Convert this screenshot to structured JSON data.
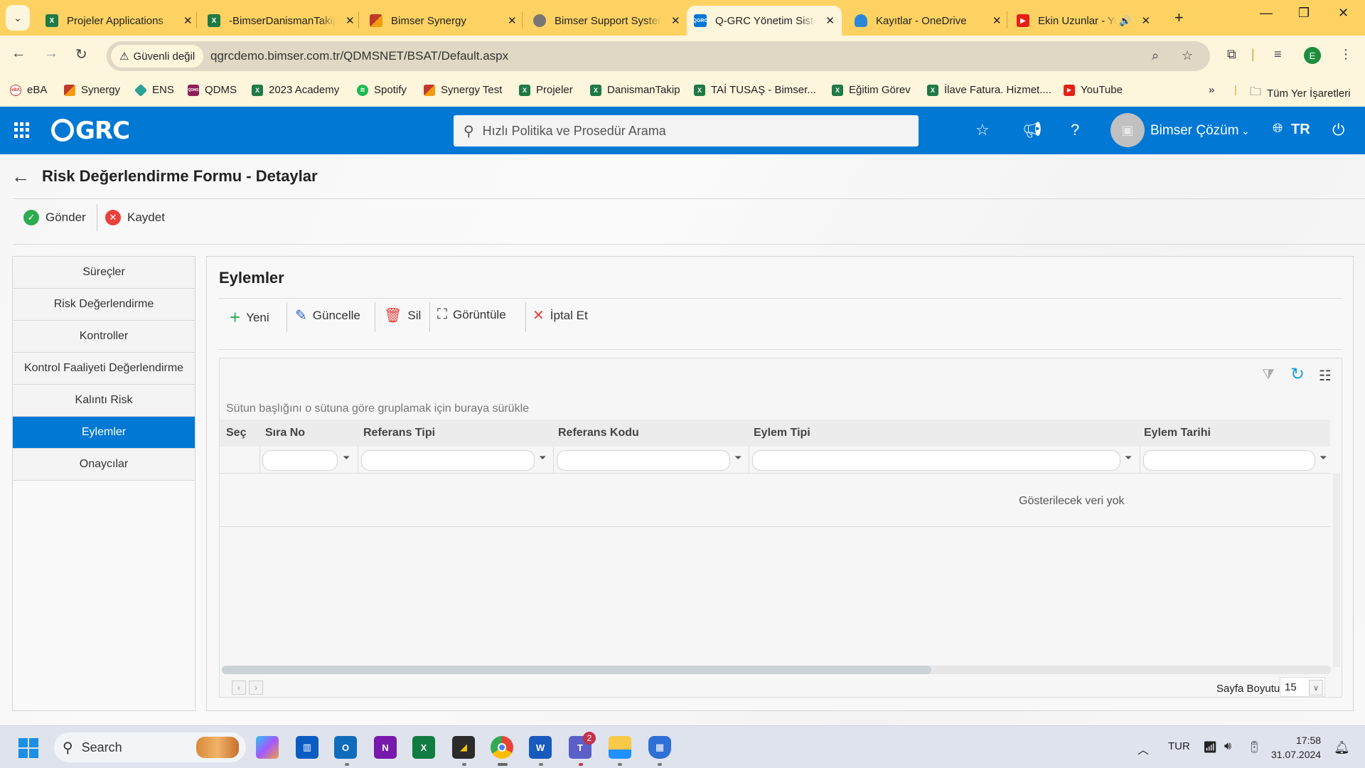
{
  "browser": {
    "tabs": [
      {
        "title": "Projeler Applications",
        "icon": "excel-icon",
        "color": "#1f7a45"
      },
      {
        "title": "-BimserDanismanTakip",
        "icon": "excel-icon",
        "color": "#1f7a45"
      },
      {
        "title": "Bimser Synergy",
        "icon": "synergy-icon",
        "color": "#c0392b"
      },
      {
        "title": "Bimser Support System",
        "icon": "globe-icon",
        "color": "#666666"
      },
      {
        "title": "Q-GRC Yönetim Sistemi",
        "icon": "qgrc-icon",
        "color": "#0078d4",
        "active": true
      },
      {
        "title": "Kayıtlar - OneDrive",
        "icon": "onedrive-icon",
        "color": "#2b88d8"
      },
      {
        "title": "Ekin Uzunlar - YouTube",
        "icon": "youtube-icon",
        "color": "#e62117"
      }
    ],
    "new_tab": "+",
    "security_label": "Güvenli değil",
    "url": "qgrcdemo.bimser.com.tr/QDMSNET/BSAT/Default.aspx",
    "profile_initial": "E",
    "bookmarks": [
      {
        "label": "eBA",
        "icon": "eba-icon",
        "color": "#c0392b"
      },
      {
        "label": "Synergy",
        "icon": "synergy-icon",
        "color": "#c0392b"
      },
      {
        "label": "ENS",
        "icon": "ens-icon",
        "color": "#2aa198"
      },
      {
        "label": "QDMS",
        "icon": "qdms-icon",
        "color": "#8e1f5a"
      },
      {
        "label": "2023 Academy",
        "icon": "excel-icon",
        "color": "#1f7a45"
      },
      {
        "label": "Spotify",
        "icon": "spotify-icon",
        "color": "#1db954"
      },
      {
        "label": "Synergy Test",
        "icon": "synergy-icon",
        "color": "#c0392b"
      },
      {
        "label": "Projeler",
        "icon": "excel-icon",
        "color": "#1f7a45"
      },
      {
        "label": "DanismanTakip",
        "icon": "excel-icon",
        "color": "#1f7a45"
      },
      {
        "label": "TAİ TUSAŞ - Bimser...",
        "icon": "excel-icon",
        "color": "#1f7a45"
      },
      {
        "label": "Eğitim Görev",
        "icon": "excel-icon",
        "color": "#1f7a45"
      },
      {
        "label": "İlave Fatura. Hizmet....",
        "icon": "excel-icon",
        "color": "#1f7a45"
      },
      {
        "label": "YouTube",
        "icon": "youtube-icon",
        "color": "#e62117"
      }
    ],
    "bookmarks_overflow": "»",
    "all_bookmarks": "Tüm Yer İşaretleri"
  },
  "app": {
    "logo": "GRC",
    "search_placeholder": "Hızlı Politika ve Prosedür Arama",
    "user_name": "Bimser Çözüm",
    "language": "TR",
    "brand_color": "#0078d4"
  },
  "page": {
    "title": "Risk Değerlendirme Formu - Detaylar",
    "actions": {
      "send": "Gönder",
      "save": "Kaydet"
    },
    "sidebar": [
      {
        "label": "Süreçler"
      },
      {
        "label": "Risk Değerlendirme"
      },
      {
        "label": "Kontroller"
      },
      {
        "label": "Kontrol Faaliyeti Değerlendirme"
      },
      {
        "label": "Kalıntı Risk"
      },
      {
        "label": "Eylemler",
        "active": true
      },
      {
        "label": "Onaycılar"
      }
    ],
    "panel": {
      "title": "Eylemler",
      "toolbar": {
        "new": "Yeni",
        "update": "Güncelle",
        "delete": "Sil",
        "view": "Görüntüle",
        "cancel": "İptal Et"
      },
      "group_hint": "Sütun başlığını o sütuna göre gruplamak için buraya sürükle",
      "columns": [
        "Seç",
        "Sıra No",
        "Referans Tipi",
        "Referans Kodu",
        "Eylem Tipi",
        "Eylem Tarihi"
      ],
      "empty_text": "Gösterilecek veri yok",
      "page_size_label": "Sayfa Boyutu:",
      "page_size": "15",
      "hscroll_fraction": 0.64
    }
  },
  "taskbar": {
    "search_label": "Search",
    "teams_badge": "2",
    "language": "TUR",
    "time": "17:58",
    "date": "31.07.2024"
  }
}
